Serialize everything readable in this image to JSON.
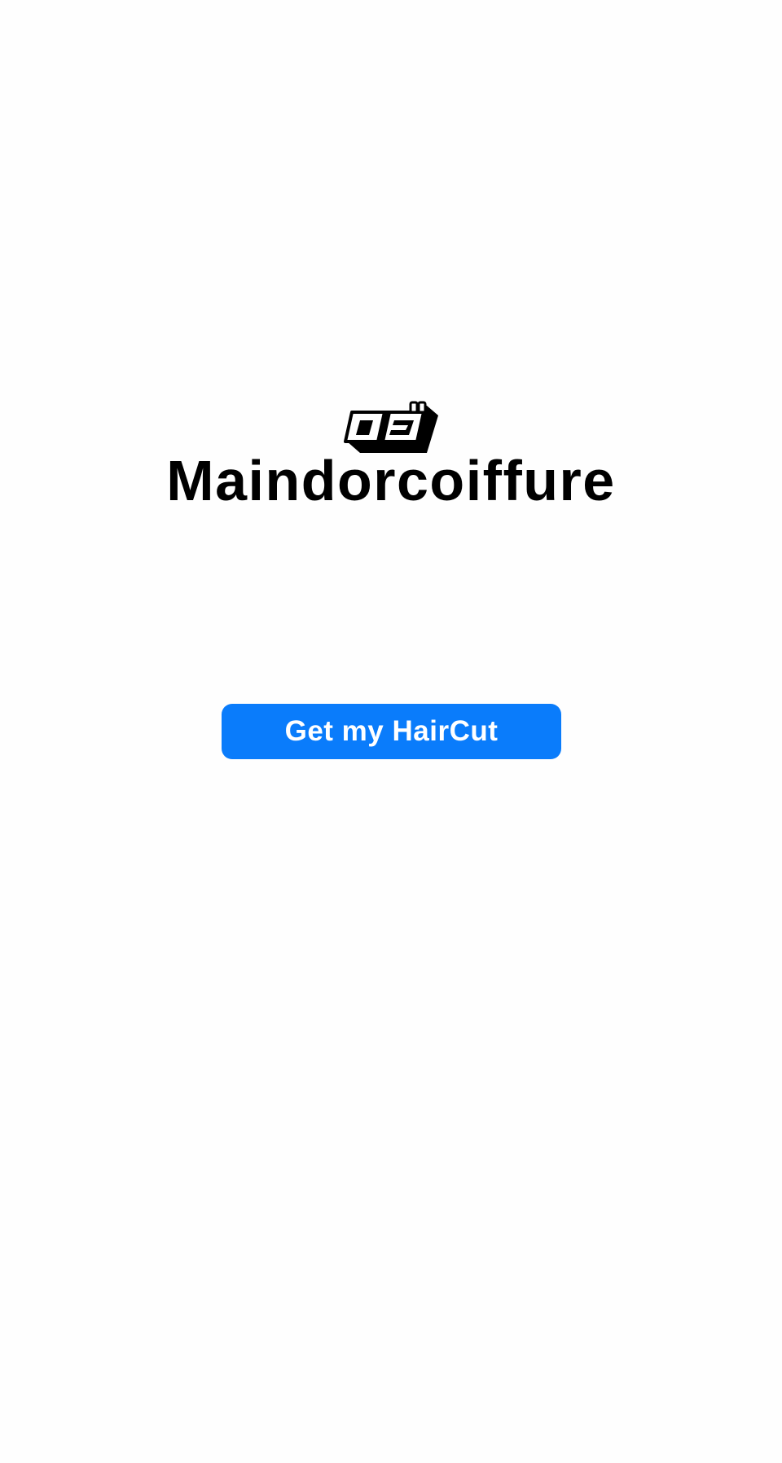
{
  "brand": {
    "name": "Maindorcoiffure",
    "logo_icon": "scissors-comb-logo-icon"
  },
  "actions": {
    "primary_label": "Get my HairCut"
  },
  "colors": {
    "background": "#fefefe",
    "text": "#000000",
    "primary_button": "#0a7cfb",
    "primary_button_text": "#ffffff"
  }
}
